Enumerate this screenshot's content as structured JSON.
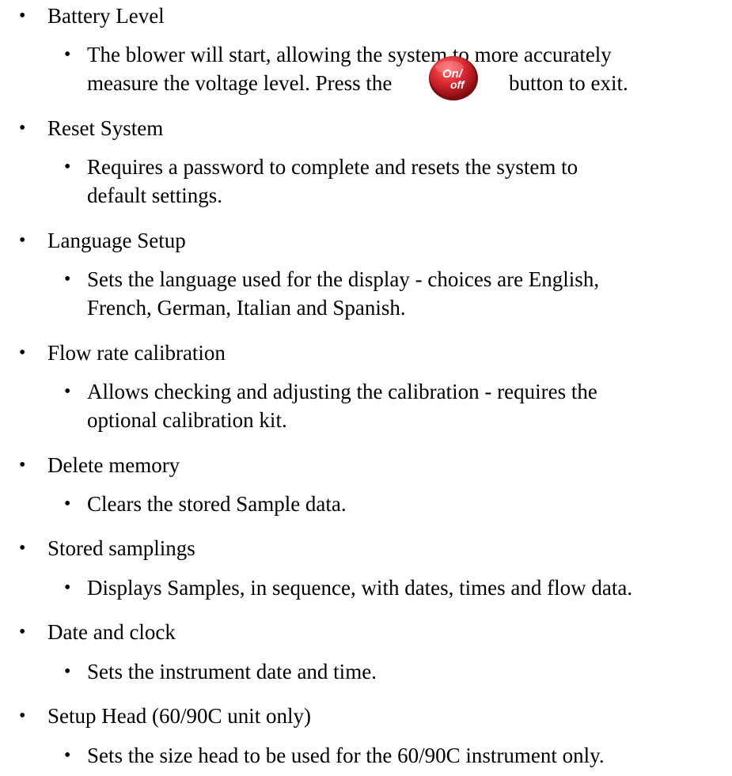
{
  "items": [
    {
      "heading": "Battery Level",
      "detail_lines": [
        "The blower will start, allowing the system to more accurately",
        "measure the voltage level. Press the",
        "button to exit."
      ],
      "inline_button_label": "On/off",
      "inline_button_color": "#d8262e"
    },
    {
      "heading": "Reset System",
      "detail_lines": [
        "Requires a password to complete and resets the system to",
        "default settings."
      ]
    },
    {
      "heading": "Language Setup",
      "detail_lines": [
        "Sets the language used for the display - choices are English,",
        "French, German, Italian and Spanish."
      ]
    },
    {
      "heading": "Flow rate calibration",
      "detail_lines": [
        "Allows checking and adjusting the calibration - requires the",
        "optional calibration kit."
      ]
    },
    {
      "heading": "Delete memory",
      "detail_lines": [
        "Clears the stored Sample data."
      ]
    },
    {
      "heading": "Stored samplings",
      "detail_lines": [
        "Displays Samples, in sequence, with dates, times and flow data."
      ]
    },
    {
      "heading": "Date and clock",
      "detail_lines": [
        "Sets the instrument date and time."
      ]
    },
    {
      "heading": "Setup Head (60/90C unit only)",
      "detail_lines": [
        "Sets the size head to be used for the 60/90C instrument only."
      ]
    }
  ],
  "bullet_glyph": "•"
}
